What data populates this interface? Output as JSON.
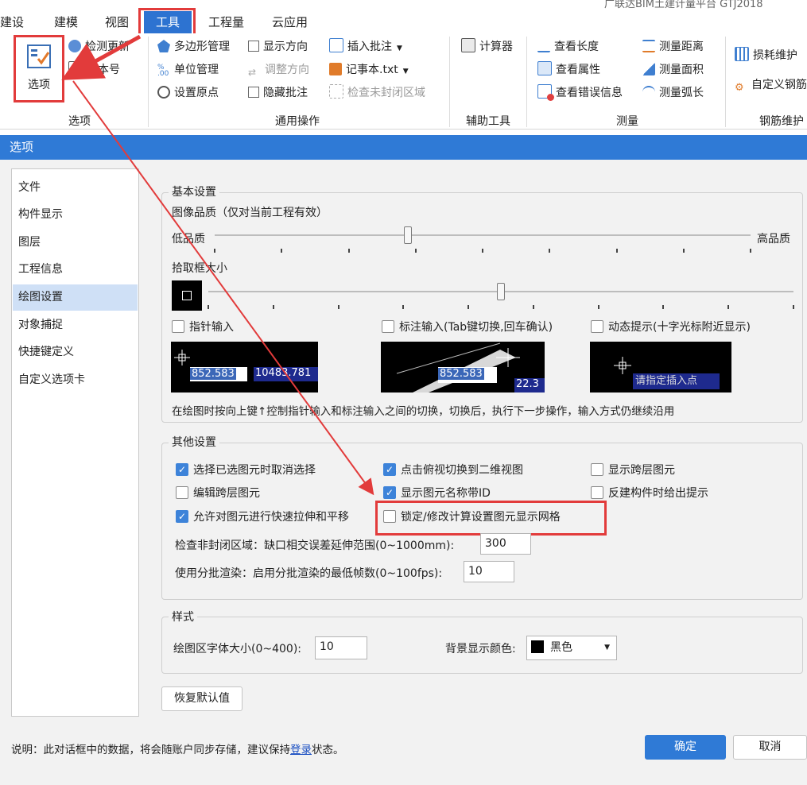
{
  "app": {
    "title_fragment": "广联达BIM土建计量平台 GTJ2018"
  },
  "tabs": [
    {
      "label": "建设置"
    },
    {
      "label": "建模"
    },
    {
      "label": "视图"
    },
    {
      "label": "工具"
    },
    {
      "label": "工程量"
    },
    {
      "label": "云应用"
    }
  ],
  "ribbon": {
    "options_group": {
      "big_button": "选项",
      "check_update": "检测更新",
      "version": "版本号",
      "label": "选项"
    },
    "common_ops": {
      "label": "通用操作",
      "polygon": "多边形管理",
      "unit": "单位管理",
      "origin": "设置原点",
      "show_dir": "显示方向",
      "adjust_dir": "调整方向",
      "hide_note": "隐藏批注",
      "insert_note": "插入批注",
      "notepad": "记事本.txt",
      "check_unclosed": "检查未封闭区域"
    },
    "aux_tools": {
      "label": "辅助工具",
      "calculator": "计算器"
    },
    "measure": {
      "label": "测量",
      "view_length": "查看长度",
      "view_attr": "查看属性",
      "view_errors": "查看错误信息",
      "measure_dist": "测量距离",
      "measure_area": "测量面积",
      "measure_arc": "测量弧长"
    },
    "rebar": {
      "label": "钢筋维护",
      "loss": "损耗维护",
      "custom": "自定义钢筋"
    }
  },
  "dialog": {
    "title": "选项",
    "nav": [
      "文件",
      "构件显示",
      "图层",
      "工程信息",
      "绘图设置",
      "对象捕捉",
      "快捷键定义",
      "自定义选项卡"
    ],
    "nav_selected": "绘图设置",
    "basic": {
      "legend": "基本设置",
      "quality_label": "图像品质（仅对当前工程有效）",
      "low": "低品质",
      "high": "高品质",
      "quality_value": 0.36,
      "pickbox_label": "拾取框大小",
      "pickbox_value": 0.5,
      "pointer_input": "指针输入",
      "dim_input": "标注输入(Tab键切换,回车确认)",
      "dynamic_hint": "动态提示(十字光标附近显示)",
      "preview1_a": "852.583",
      "preview1_b": "10483.781",
      "preview2_a": "852.583",
      "preview2_b": "22.3",
      "preview3": "请指定插入点",
      "help": "在绘图时按向上键↑控制指针输入和标注输入之间的切换，切换后，执行下一步操作，输入方式仍继续沿用"
    },
    "other": {
      "legend": "其他设置",
      "cb1": "选择已选图元时取消选择",
      "cb2": "点击俯视切换到二维视图",
      "cb3": "显示跨层图元",
      "cb4": "编辑跨层图元",
      "cb5": "显示图元名称带ID",
      "cb6": "反建构件时给出提示",
      "cb7": "允许对图元进行快速拉伸和平移",
      "cb8": "锁定/修改计算设置图元显示网格",
      "gap_label": "检查非封闭区域：缺口相交误差延伸范围(0~1000mm):",
      "gap_value": "300",
      "batch_label": "使用分批渲染：启用分批渲染的最低帧数(0~100fps):",
      "batch_value": "10"
    },
    "style": {
      "legend": "样式",
      "font_label": "绘图区字体大小(0~400):",
      "font_value": "10",
      "bg_label": "背景显示颜色:",
      "bg_value": "黑色"
    },
    "restore": "恢复默认值",
    "note_prefix": "说明：此对话框中的数据，将会随账户同步存储，建议保持",
    "note_link": "登录",
    "note_suffix": "状态。",
    "ok": "确定",
    "cancel": "取消"
  },
  "colors": {
    "accent": "#2f7ad6",
    "annotation": "#e23b3b"
  }
}
